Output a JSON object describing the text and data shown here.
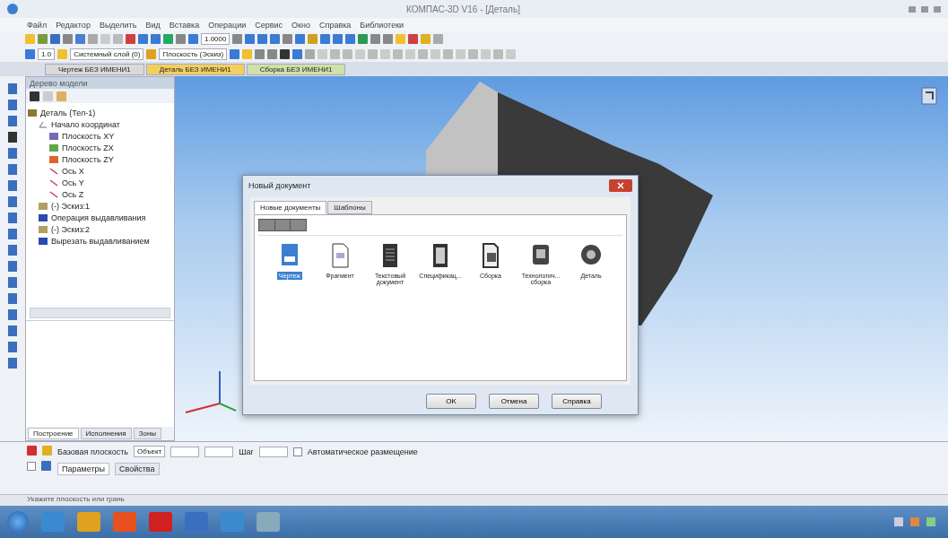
{
  "window": {
    "title": "КОМПАС-3D V16 - [Деталь]"
  },
  "menu": [
    "Файл",
    "Редактор",
    "Выделить",
    "Вид",
    "Вставка",
    "Операции",
    "Сервис",
    "Окно",
    "Справка",
    "Библиотеки"
  ],
  "toolbar": {
    "scale": "1.0000",
    "step": "1.0",
    "layer": "Системный слой (0)",
    "view": "Плоскость (Эскиз)"
  },
  "doc_tabs": [
    {
      "label": "Чертеж БЕЗ ИМЕНИ1",
      "selected": false
    },
    {
      "label": "Деталь БЕЗ ИМЕНИ1",
      "selected": true
    },
    {
      "label": "Сборка БЕЗ ИМЕНИ1",
      "selected": false
    }
  ],
  "tree": {
    "title": "Дерево модели",
    "items": [
      {
        "label": "Деталь (Тел-1)",
        "kind": "part",
        "children": [
          {
            "label": "Начало координат",
            "kind": "origin",
            "children": [
              {
                "label": "Плоскость XY",
                "kind": "plane",
                "color": "#7b68b5"
              },
              {
                "label": "Плоскость ZX",
                "kind": "plane",
                "color": "#5fa84a"
              },
              {
                "label": "Плоскость ZY",
                "kind": "plane",
                "color": "#e0642a"
              },
              {
                "label": "Ось X",
                "kind": "axis"
              },
              {
                "label": "Ось Y",
                "kind": "axis"
              },
              {
                "label": "Ось Z",
                "kind": "axis"
              }
            ]
          },
          {
            "label": "(-) Эскиз:1",
            "kind": "sketch"
          },
          {
            "label": "Операция выдавливания",
            "kind": "operation"
          },
          {
            "label": "(-) Эскиз:2",
            "kind": "sketch"
          },
          {
            "label": "Вырезать выдавливанием",
            "kind": "operation"
          }
        ]
      }
    ],
    "tabs": [
      {
        "label": "Построение",
        "selected": true
      },
      {
        "label": "Исполнения",
        "selected": false
      },
      {
        "label": "Зоны",
        "selected": false
      }
    ]
  },
  "dialog": {
    "title": "Новый документ",
    "tabs": [
      {
        "label": "Новые документы",
        "selected": true
      },
      {
        "label": "Шаблоны",
        "selected": false
      }
    ],
    "items": [
      {
        "label": "Чертеж",
        "kind": "drawing",
        "selected": true
      },
      {
        "label": "Фрагмент",
        "kind": "fragment",
        "selected": false
      },
      {
        "label": "Текстовый документ",
        "kind": "text",
        "selected": false
      },
      {
        "label": "Спецификац...",
        "kind": "spec",
        "selected": false
      },
      {
        "label": "Сборка",
        "kind": "assembly",
        "selected": false
      },
      {
        "label": "Технологич... сборка",
        "kind": "tech",
        "selected": false
      },
      {
        "label": "Деталь",
        "kind": "part",
        "selected": false
      }
    ],
    "buttons": [
      "OK",
      "Отмена",
      "Справка"
    ]
  },
  "properties": {
    "base_label": "Базовая плоскость",
    "object_value": "Объект",
    "step_label": "Шаг",
    "auto_label": "Автоматическое размещение",
    "row_checked": false,
    "auto_checked": false,
    "tabs": [
      {
        "label": "Параметры",
        "selected": true
      },
      {
        "label": "Свойства",
        "selected": false
      }
    ]
  },
  "status_bar": {
    "text": "Укажите плоскость или грань"
  }
}
